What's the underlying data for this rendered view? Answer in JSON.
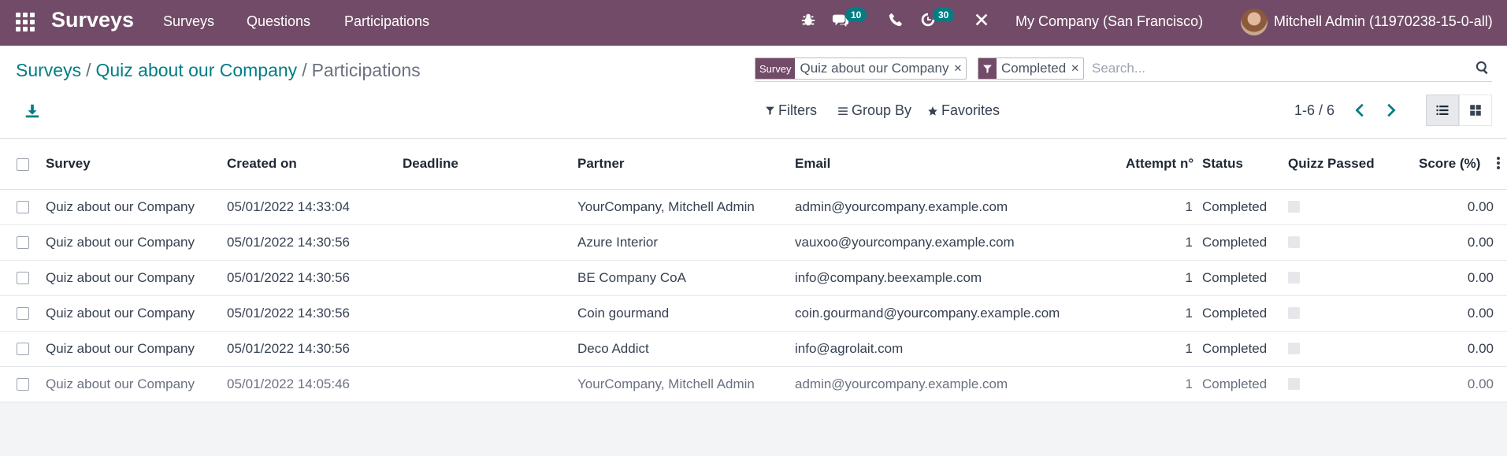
{
  "navbar": {
    "app_name": "Surveys",
    "menus": [
      "Surveys",
      "Questions",
      "Participations"
    ],
    "messages_count": "10",
    "activities_count": "30",
    "company": "My Company (San Francisco)",
    "user": "Mitchell Admin (11970238-15-0-all)"
  },
  "breadcrumb": {
    "root": "Surveys",
    "survey": "Quiz about our Company",
    "current": "Participations",
    "separator": "/"
  },
  "search": {
    "facets": [
      {
        "label": "Survey",
        "value": "Quiz about our Company"
      },
      {
        "label": "",
        "value": "Completed"
      }
    ],
    "placeholder": "Search..."
  },
  "toolbar": {
    "filters": "Filters",
    "group_by": "Group By",
    "favorites": "Favorites",
    "pager": "1-6 / 6"
  },
  "table": {
    "columns": [
      "Survey",
      "Created on",
      "Deadline",
      "Partner",
      "Email",
      "Attempt n°",
      "Status",
      "Quizz Passed",
      "Score (%)"
    ],
    "rows": [
      {
        "survey": "Quiz about our Company",
        "created": "05/01/2022 14:33:04",
        "deadline": "",
        "partner": "YourCompany, Mitchell Admin",
        "email": "admin@yourcompany.example.com",
        "attempt": "1",
        "status": "Completed",
        "score": "0.00"
      },
      {
        "survey": "Quiz about our Company",
        "created": "05/01/2022 14:30:56",
        "deadline": "",
        "partner": "Azure Interior",
        "email": "vauxoo@yourcompany.example.com",
        "attempt": "1",
        "status": "Completed",
        "score": "0.00"
      },
      {
        "survey": "Quiz about our Company",
        "created": "05/01/2022 14:30:56",
        "deadline": "",
        "partner": "BE Company CoA",
        "email": "info@company.beexample.com",
        "attempt": "1",
        "status": "Completed",
        "score": "0.00"
      },
      {
        "survey": "Quiz about our Company",
        "created": "05/01/2022 14:30:56",
        "deadline": "",
        "partner": "Coin gourmand",
        "email": "coin.gourmand@yourcompany.example.com",
        "attempt": "1",
        "status": "Completed",
        "score": "0.00"
      },
      {
        "survey": "Quiz about our Company",
        "created": "05/01/2022 14:30:56",
        "deadline": "",
        "partner": "Deco Addict",
        "email": "info@agrolait.com",
        "attempt": "1",
        "status": "Completed",
        "score": "0.00"
      },
      {
        "survey": "Quiz about our Company",
        "created": "05/01/2022 14:05:46",
        "deadline": "",
        "partner": "YourCompany, Mitchell Admin",
        "email": "admin@yourcompany.example.com",
        "attempt": "1",
        "status": "Completed",
        "score": "0.00"
      }
    ]
  },
  "colors": {
    "brand": "#714b67",
    "link": "#017e84",
    "badge": "#017e84"
  }
}
